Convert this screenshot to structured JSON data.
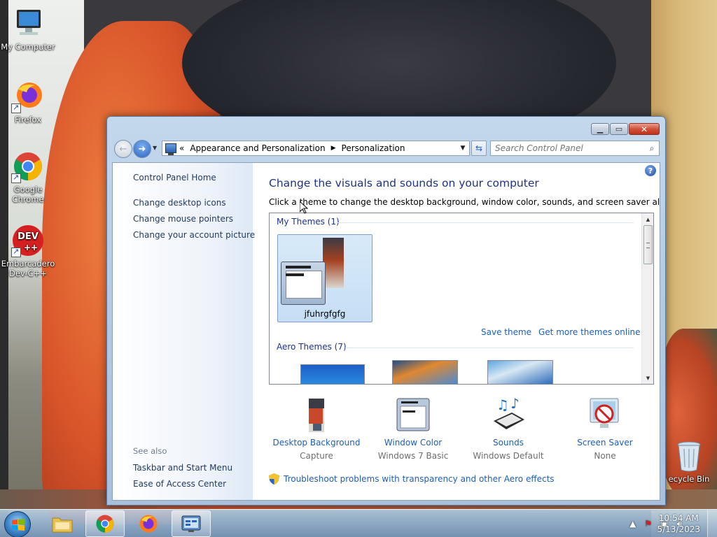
{
  "desktop": {
    "icons": [
      {
        "label": "My Computer"
      },
      {
        "label": "Firefox"
      },
      {
        "label": "Google Chrome"
      },
      {
        "label": "Embarcadero Dev-C++"
      },
      {
        "label": "ecycle Bin"
      }
    ]
  },
  "window": {
    "address": {
      "overflow": "«",
      "crumbs": [
        "Appearance and Personalization",
        "Personalization"
      ]
    },
    "search_placeholder": "Search Control Panel",
    "sidebar": {
      "home": "Control Panel Home",
      "links": [
        "Change desktop icons",
        "Change mouse pointers",
        "Change your account picture"
      ],
      "see_also_heading": "See also",
      "see_also": [
        "Taskbar and Start Menu",
        "Ease of Access Center"
      ]
    },
    "main": {
      "title": "Change the visuals and sounds on your computer",
      "description": "Click a theme to change the desktop background, window color, sounds, and screen saver all at once.",
      "my_themes_heading": "My Themes (1)",
      "theme_name": "jfuhrgfgfg",
      "save_theme": "Save theme",
      "get_more": "Get more themes online",
      "aero_heading": "Aero Themes (7)",
      "bottom": [
        {
          "label": "Desktop Background",
          "value": "Capture"
        },
        {
          "label": "Window Color",
          "value": "Windows 7 Basic"
        },
        {
          "label": "Sounds",
          "value": "Windows Default"
        },
        {
          "label": "Screen Saver",
          "value": "None"
        }
      ],
      "troubleshoot": "Troubleshoot problems with transparency and other Aero effects"
    }
  },
  "taskbar": {
    "clock_time": "10:54 AM",
    "clock_date": "5/13/2023"
  },
  "colors": {
    "link": "#1e5fb4",
    "heading": "#1e3287",
    "sidebar_link": "#1e395b",
    "secondary_text": "#6d6d6d"
  }
}
